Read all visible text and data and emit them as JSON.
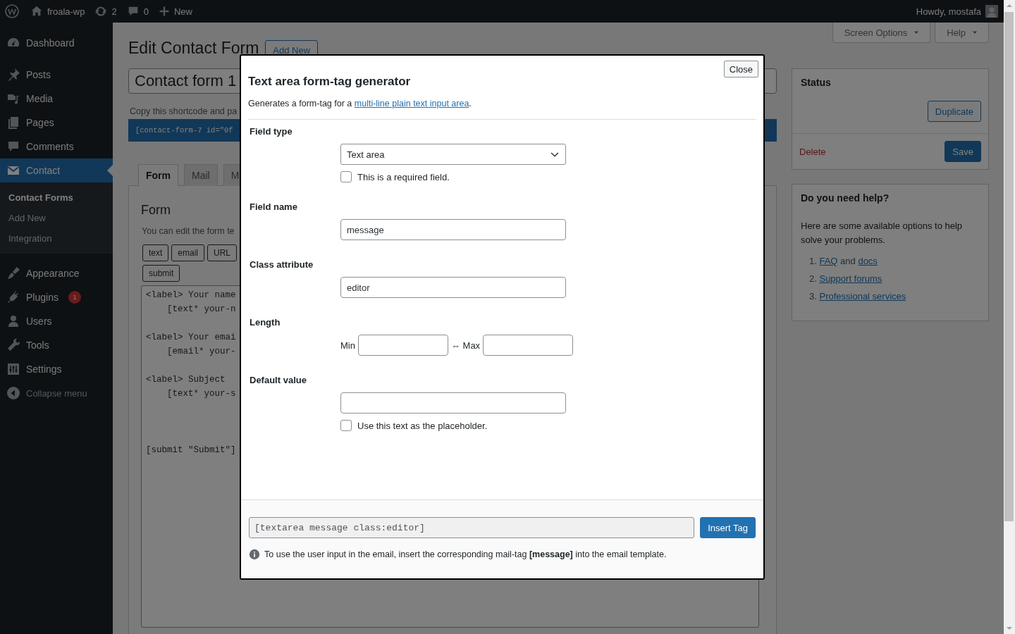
{
  "admin_bar": {
    "site": "froala-wp",
    "updates": "2",
    "comments": "0",
    "new": "New",
    "greeting": "Howdy, mostafa"
  },
  "menu": [
    {
      "label": "Dashboard",
      "selected": false
    },
    {
      "label": "Posts",
      "selected": false
    },
    {
      "label": "Media",
      "selected": false
    },
    {
      "label": "Pages",
      "selected": false
    },
    {
      "label": "Comments",
      "selected": false
    },
    {
      "label": "Contact",
      "selected": true,
      "submenu": [
        {
          "label": "Contact Forms",
          "selected": true
        },
        {
          "label": "Add New",
          "selected": false
        },
        {
          "label": "Integration",
          "selected": false
        }
      ]
    },
    {
      "label": "Appearance",
      "selected": false
    },
    {
      "label": "Plugins",
      "selected": false,
      "badge": "1"
    },
    {
      "label": "Users",
      "selected": false
    },
    {
      "label": "Tools",
      "selected": false
    },
    {
      "label": "Settings",
      "selected": false
    },
    {
      "label": "Collapse menu",
      "selected": false
    }
  ],
  "page": {
    "title": "Edit Contact Form",
    "add_new": "Add New",
    "screen_options": "Screen Options",
    "help": "Help",
    "form_title": "Contact form 1",
    "shortcode_hint": "Copy this shortcode and pa",
    "shortcode": "[contact-form-7 id=\"0f",
    "tabs": [
      {
        "label": "Form",
        "selected": true
      },
      {
        "label": "Mail",
        "selected": false
      },
      {
        "label": "M",
        "selected": false
      }
    ],
    "panel_title": "Form",
    "panel_hint": "You can edit the form te",
    "tag_buttons": [
      "text",
      "email",
      "URL",
      "submit"
    ],
    "code": "<label> Your name\n    [text* your-n\n\n<label> Your emai\n    [email* your-\n\n<label> Subject\n    [text* your-s\n\n\n\n[submit \"Submit\"]"
  },
  "status_box": {
    "title": "Status",
    "duplicate": "Duplicate",
    "delete": "Delete",
    "save": "Save"
  },
  "help_box": {
    "title": "Do you need help?",
    "text": "Here are some available options to help solve your problems.",
    "items": [
      {
        "number": "1.",
        "links": [
          "FAQ",
          "docs"
        ],
        "joiner": "and"
      },
      {
        "number": "2.",
        "links": [
          "Support forums"
        ]
      },
      {
        "number": "3.",
        "links": [
          "Professional services"
        ]
      }
    ]
  },
  "modal": {
    "close": "Close",
    "title": "Text area form-tag generator",
    "description": "Generates a form-tag for a ",
    "description_link": "multi-line plain text input area",
    "description_end": ".",
    "fields": [
      {
        "kind": "select",
        "label": "Field type",
        "value": "Text area",
        "checkbox": {
          "label": "This is a required field.",
          "checked": false
        }
      },
      {
        "kind": "text",
        "label": "Field name",
        "value": "message"
      },
      {
        "kind": "text",
        "label": "Class attribute",
        "value": "editor"
      },
      {
        "kind": "range",
        "label": "Length",
        "min_label": "Min",
        "max_label": "⇔ Max"
      },
      {
        "kind": "text",
        "label": "Default value",
        "checkbox": {
          "label": "Use this text as the placeholder.",
          "checked": false
        }
      }
    ],
    "tag_code": "[textarea message class:editor]",
    "insert": "Insert Tag",
    "note": "To use the user input in the email, insert the corresponding mail-tag **[message]** into the email template."
  }
}
